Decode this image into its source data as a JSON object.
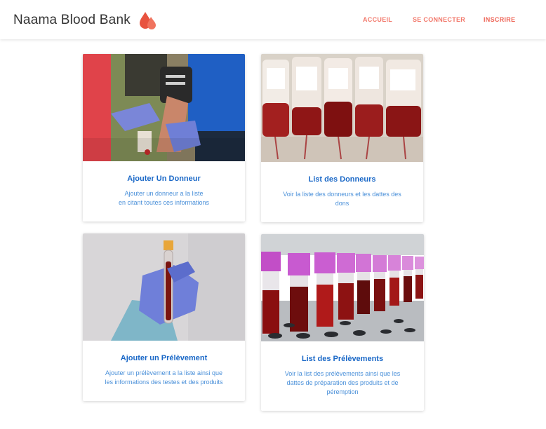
{
  "brand": {
    "title": "Naama Blood Bank",
    "icon": "blood-drops-icon",
    "accent": "#e8533f"
  },
  "nav": {
    "links": [
      "ACCUEIL",
      "SE CONNECTER",
      "INSCRIRE"
    ],
    "color": "#f2786b"
  },
  "cards": [
    {
      "title": "Ajouter Un Donneur",
      "description": [
        "Ajouter un donneur a la liste",
        "en citant toutes ces informations"
      ],
      "image": "donor-arm-photo"
    },
    {
      "title": "List des Donneurs",
      "description": [
        "Voir la liste des donneurs et les dattes des",
        "dons"
      ],
      "image": "blood-bags-photo"
    },
    {
      "title": "Ajouter un Prélèvement",
      "description": [
        "Ajouter un prélèvement a la liste ainsi que",
        "les informations des testes et des produits"
      ],
      "image": "blood-tube-photo"
    },
    {
      "title": "List des Prélèvements",
      "description": [
        "Voir la list des prélèvements ainsi que les",
        "dattes de préparation des produits et de",
        "péremption"
      ],
      "image": "tube-rack-photo"
    }
  ]
}
